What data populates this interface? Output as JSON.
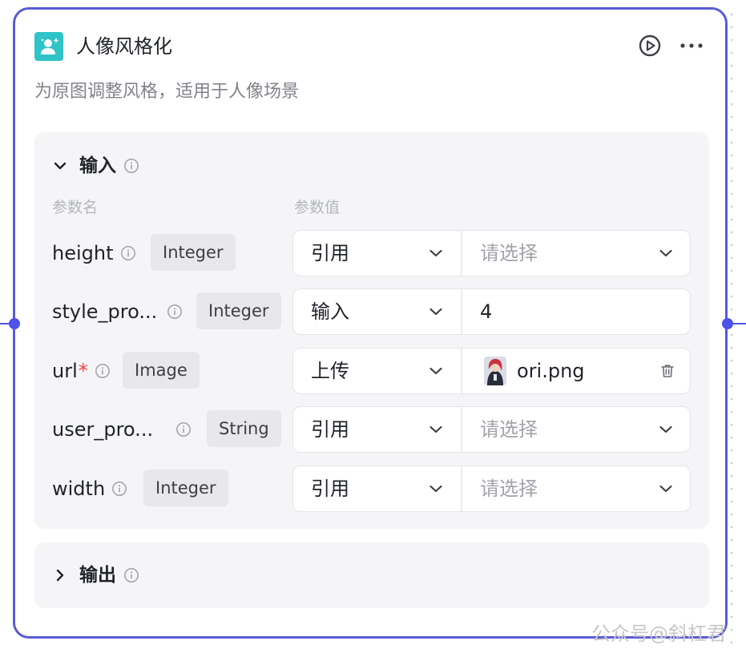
{
  "node": {
    "title": "人像风格化",
    "description": "为原图调整风格，适用于人像场景",
    "icon": "portrait-sparkle-icon"
  },
  "input_section": {
    "title": "输入",
    "expanded": true,
    "columns": {
      "name": "参数名",
      "value": "参数值"
    },
    "params": [
      {
        "name": "height",
        "required": false,
        "type": "Integer",
        "mode": "引用",
        "value": "",
        "placeholder": "请选择"
      },
      {
        "name": "style_pro...",
        "required": false,
        "type": "Integer",
        "mode": "输入",
        "value": "4",
        "placeholder": ""
      },
      {
        "name": "url",
        "required": true,
        "type": "Image",
        "mode": "上传",
        "value": "ori.png",
        "placeholder": ""
      },
      {
        "name": "user_pro...",
        "required": false,
        "type": "String",
        "mode": "引用",
        "value": "",
        "placeholder": "请选择"
      },
      {
        "name": "width",
        "required": false,
        "type": "Integer",
        "mode": "引用",
        "value": "",
        "placeholder": "请选择"
      }
    ]
  },
  "output_section": {
    "title": "输出",
    "expanded": false
  },
  "required_mark": "*",
  "watermark": "公众号@斜杠君",
  "colors": {
    "border_accent": "#5b5bd6",
    "port": "#4d53e8",
    "node_icon_bg": "#2ec3c9",
    "required": "#f53f3f",
    "panel_bg": "#f5f5f7"
  }
}
